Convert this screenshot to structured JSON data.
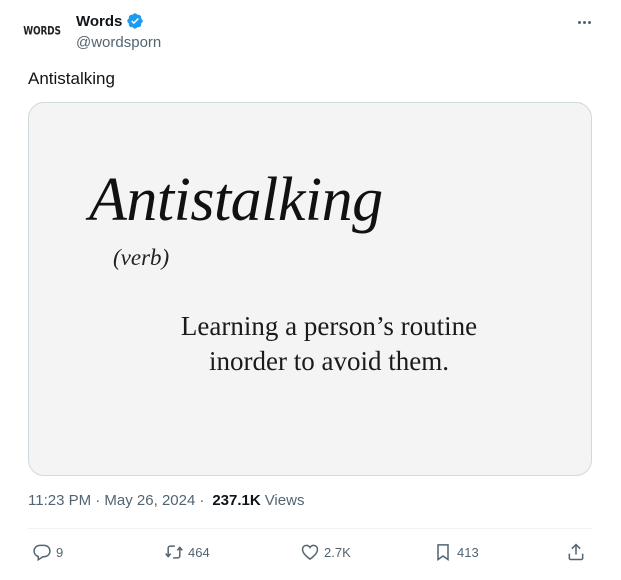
{
  "author": {
    "avatar_text": "WORDS",
    "display_name": "Words",
    "handle": "@wordsporn",
    "verified": true
  },
  "tweet": {
    "text": "Antistalking",
    "timestamp": "11:23 PM · May 26, 2024",
    "views_count": "237.1K",
    "views_label": "Views",
    "separator": "·"
  },
  "media": {
    "word": "Antistalking",
    "part_of_speech": "(verb)",
    "definition_line1": "Learning a person’s routine",
    "definition_line2": "inorder to avoid them."
  },
  "actions": {
    "replies": "9",
    "reposts": "464",
    "likes": "2.7K",
    "bookmarks": "413"
  },
  "colors": {
    "accent_verified": "#1d9bf0",
    "secondary_text": "#536471"
  }
}
